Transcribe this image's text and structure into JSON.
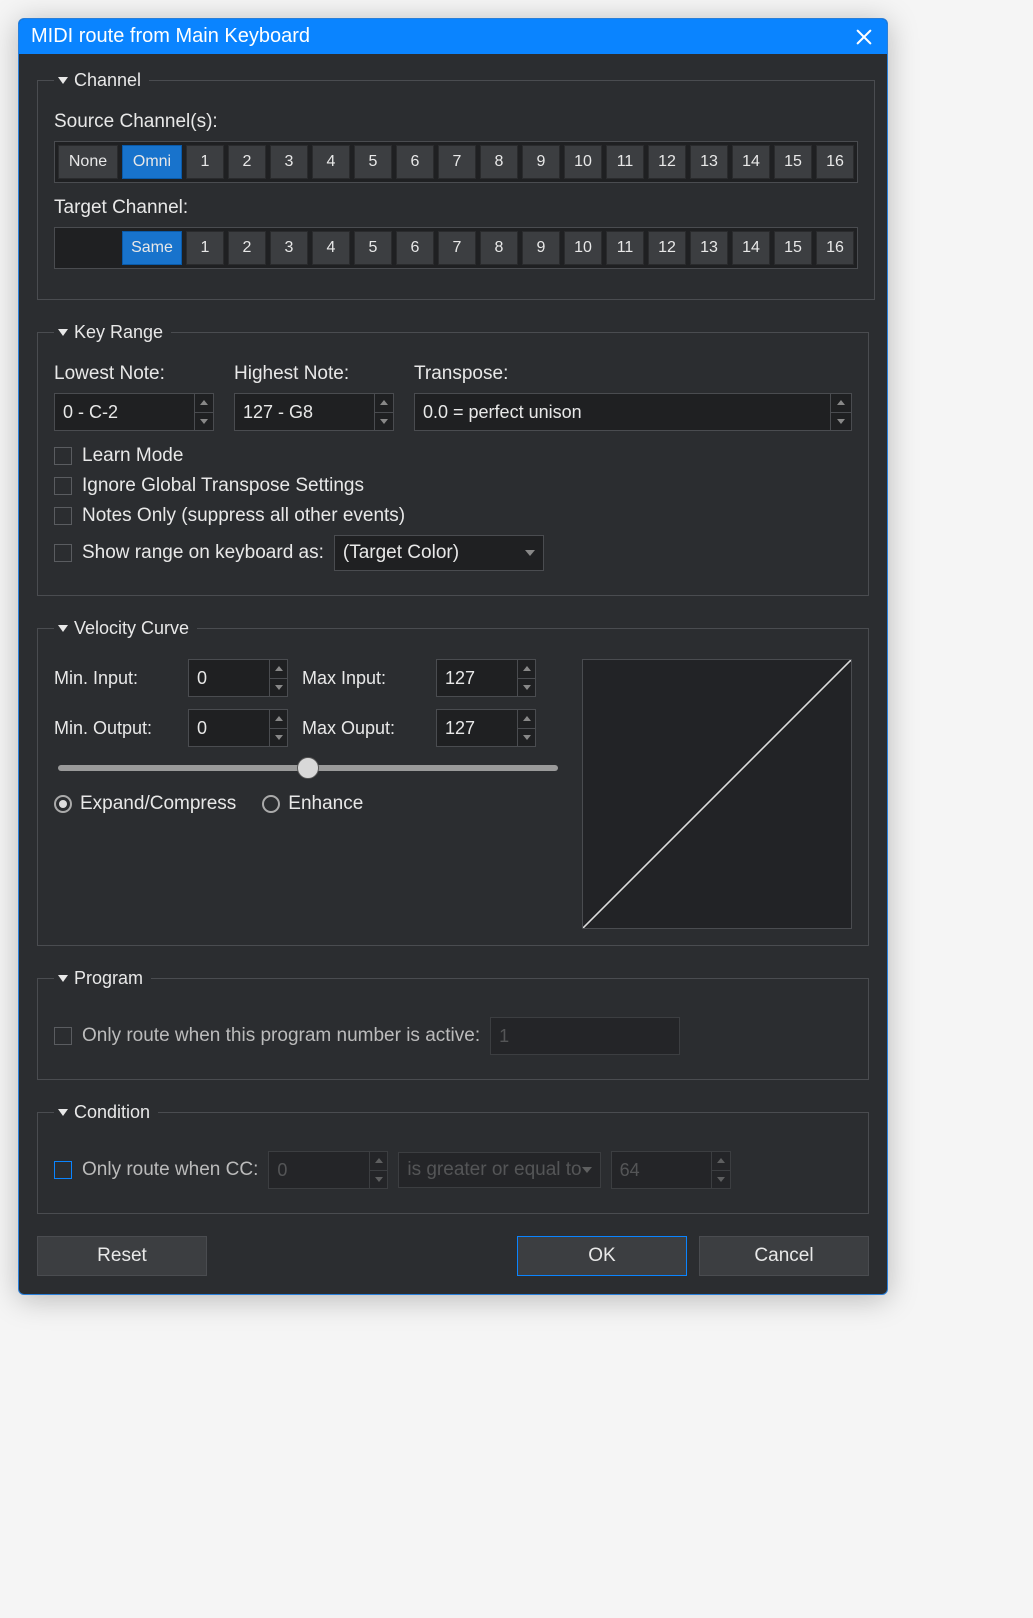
{
  "title": "MIDI route from Main Keyboard",
  "channel": {
    "legend": "Channel",
    "source_label": "Source Channel(s):",
    "target_label": "Target Channel:",
    "source_buttons": [
      "None",
      "Omni",
      "1",
      "2",
      "3",
      "4",
      "5",
      "6",
      "7",
      "8",
      "9",
      "10",
      "11",
      "12",
      "13",
      "14",
      "15",
      "16"
    ],
    "source_selected": "Omni",
    "target_buttons": [
      "",
      "Same",
      "1",
      "2",
      "3",
      "4",
      "5",
      "6",
      "7",
      "8",
      "9",
      "10",
      "11",
      "12",
      "13",
      "14",
      "15",
      "16"
    ],
    "target_selected": "Same"
  },
  "keyrange": {
    "legend": "Key Range",
    "lowest_label": "Lowest Note:",
    "highest_label": "Highest Note:",
    "transpose_label": "Transpose:",
    "lowest": "0 - C-2",
    "highest": "127 - G8",
    "transpose": "0.0 = perfect unison",
    "learn": "Learn Mode",
    "ignore": "Ignore Global Transpose Settings",
    "notes_only": "Notes Only (suppress all other events)",
    "show_range": "Show range on keyboard as:",
    "show_range_value": "(Target Color)"
  },
  "velocity": {
    "legend": "Velocity Curve",
    "min_in_label": "Min. Input:",
    "max_in_label": "Max Input:",
    "min_out_label": "Min. Output:",
    "max_out_label": "Max Ouput:",
    "min_in": "0",
    "max_in": "127",
    "min_out": "0",
    "max_out": "127",
    "expand": "Expand/Compress",
    "enhance": "Enhance",
    "mode_selected": "expand"
  },
  "program": {
    "legend": "Program",
    "only_route": "Only route when this program number is active:",
    "value": "1"
  },
  "condition": {
    "legend": "Condition",
    "only_route": "Only route when CC:",
    "cc": "0",
    "op": "is greater or equal to",
    "rhs": "64"
  },
  "footer": {
    "reset": "Reset",
    "ok": "OK",
    "cancel": "Cancel"
  }
}
